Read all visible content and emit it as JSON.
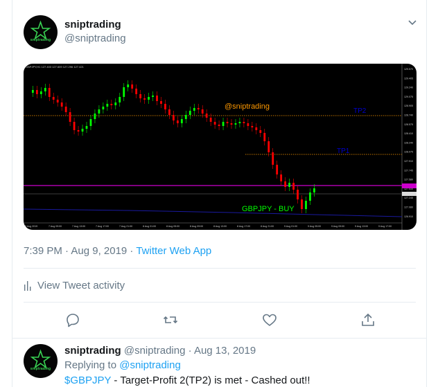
{
  "tweet": {
    "display_name": "sniptrading",
    "handle": "@sniptrading",
    "avatar_text": "sniptrading",
    "timestamp": "7:39 PM · Aug 9, 2019 · ",
    "source_app": "Twitter Web App",
    "activity_label": "View Tweet activity",
    "chart": {
      "symbol_header": "GBPJPY,H1  127.403 127.609 127.296 127.421",
      "watermark": "@sniptrading",
      "signal_label": "GBPJPY - BUY",
      "tp2_label": "TP2",
      "tp1_label": "TP1",
      "price_labels": [
        "129.570",
        "129.405",
        "129.240",
        "129.075",
        "128.905",
        "128.740",
        "128.575",
        "128.410",
        "128.240",
        "128.075",
        "127.910",
        "127.745",
        "127.580",
        "127.410",
        "127.245",
        "127.080",
        "126.910"
      ],
      "time_labels": [
        "5 Aug 2019",
        "7 Aug 09:00",
        "7 Aug 13:00",
        "7 Aug 17:00",
        "7 Aug 21:00",
        "8 Aug 01:00",
        "8 Aug 05:00",
        "8 Aug 09:00",
        "8 Aug 13:00",
        "8 Aug 17:00",
        "8 Aug 21:00",
        "9 Aug 01:00",
        "9 Aug 05:00",
        "9 Aug 09:00",
        "9 Aug 13:00",
        "9 Aug 17:00"
      ],
      "colors": {
        "bull": "#00ff00",
        "bear": "#ff0000",
        "target": "#ff9900",
        "tp_text": "#0000cc",
        "magenta": "#cc00cc"
      }
    }
  },
  "reply": {
    "display_name": "sniptrading",
    "handle_date": " @sniptrading · Aug 13, 2019",
    "replying_prefix": "Replying to ",
    "replying_handle": "@sniptrading",
    "cashtag": "$GBPJPY",
    "text": " - Target-Profit 2(TP2) is met - Cashed out!!"
  }
}
